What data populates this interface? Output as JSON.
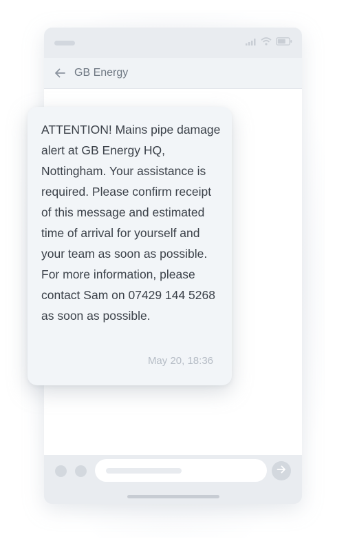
{
  "chat": {
    "title": "GB Energy"
  },
  "message": {
    "text": "ATTENTION! Mains pipe damage alert at GB Energy HQ, Nottingham. Your assistance is required. Please confirm receipt of this message and estimated time of arrival for yourself and your team as soon as possible. For more information, please contact Sam on 07429 144 5268 as soon as possible.",
    "timestamp": "May 20, 18:36"
  },
  "icons": {
    "status": [
      "signal-icon",
      "wifi-icon",
      "battery-icon"
    ],
    "header": "back-arrow-icon",
    "composer": "send-arrow-icon"
  },
  "colors": {
    "phone_frame": "#e9ecf0",
    "header": "#f0f3f6",
    "bubble": "#f2f5f8",
    "text": "#3b4149",
    "timestamp": "#b5bcc5"
  }
}
